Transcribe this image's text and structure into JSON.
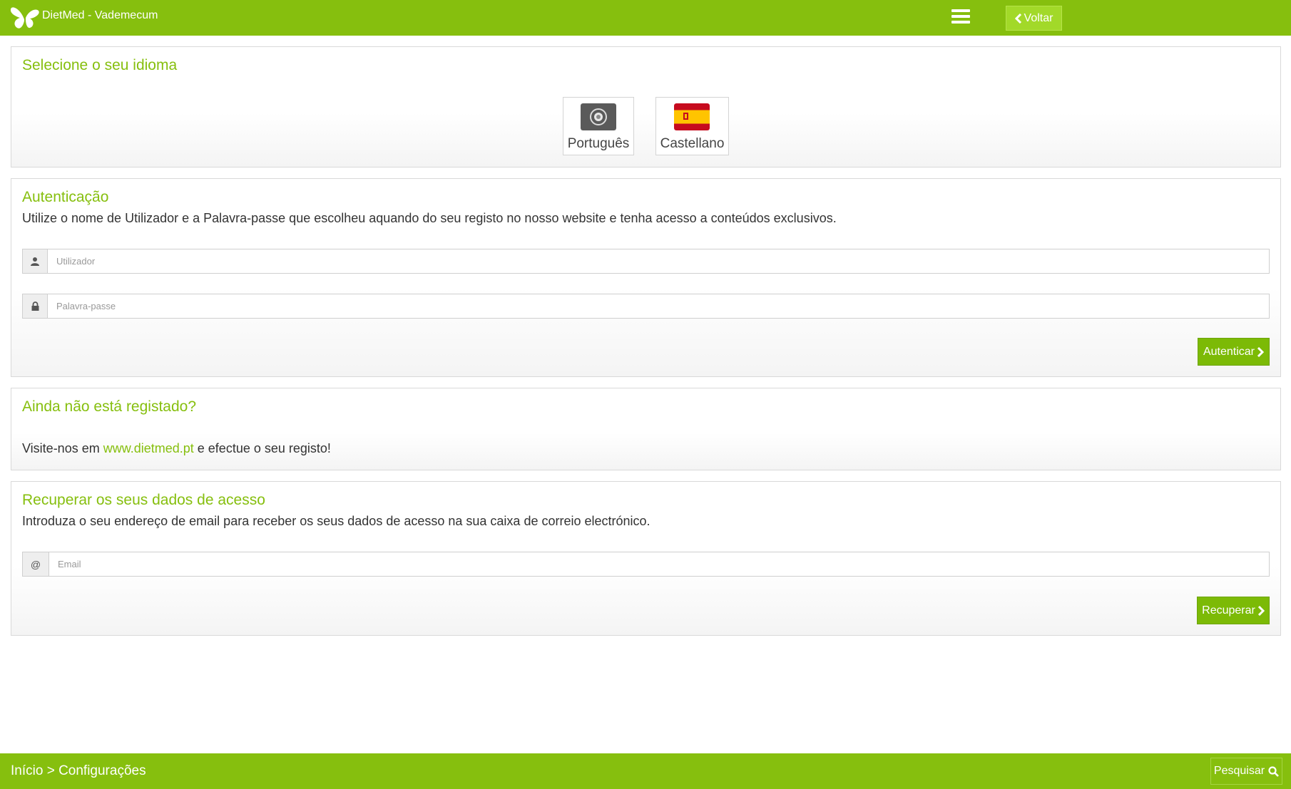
{
  "header": {
    "app_title": "DietMed - Vademecum",
    "back_label": "Voltar"
  },
  "language": {
    "title": "Selecione o seu idioma",
    "options": [
      {
        "label": "Português",
        "flag": "portugal-flag-icon"
      },
      {
        "label": "Castellano",
        "flag": "spain-flag-icon"
      }
    ]
  },
  "auth": {
    "title": "Autenticação",
    "description": "Utilize o nome de Utilizador e a Palavra-passe que escolheu aquando do seu registo no nosso website e tenha acesso a conteúdos exclusivos.",
    "username_placeholder": "Utilizador",
    "password_placeholder": "Palavra-passe",
    "submit_label": "Autenticar"
  },
  "register": {
    "title": "Ainda não está registado?",
    "text_before": "Visite-nos em ",
    "link_text": "www.dietmed.pt",
    "text_after": " e efectue o seu registo!"
  },
  "recover": {
    "title": "Recuperar os seus dados de acesso",
    "description": "Introduza o seu endereço de email para receber os seus dados de acesso na sua caixa de correio electrónico.",
    "email_addon": "@",
    "email_placeholder": "Email",
    "submit_label": "Recuperar"
  },
  "footer": {
    "breadcrumb": "Início > Configurações",
    "search_label": "Pesquisar"
  },
  "colors": {
    "brand_green": "#86bf0e",
    "button_green": "#7cba06",
    "back_button": "#a2d929"
  }
}
